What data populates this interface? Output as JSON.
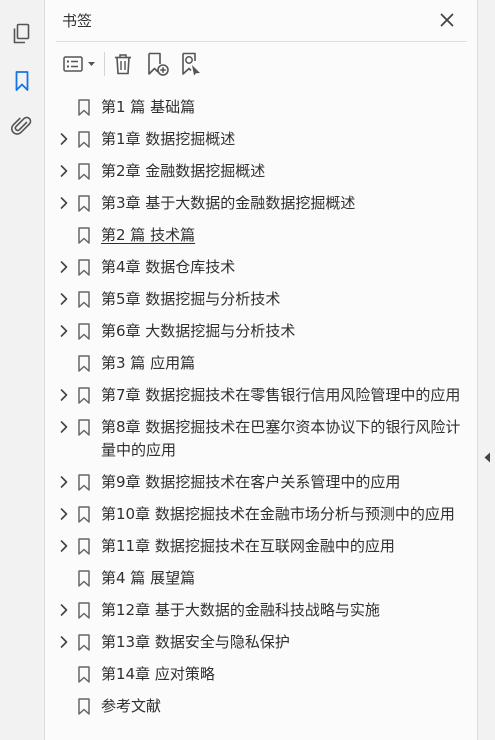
{
  "panel": {
    "title": "书签"
  },
  "left_rail": {
    "active_color": "#1473e6",
    "items": [
      {
        "name": "pages-thumbnail",
        "icon": "pages-icon"
      },
      {
        "name": "bookmarks",
        "icon": "bookmark-icon",
        "active": true
      },
      {
        "name": "attachments",
        "icon": "paperclip-icon"
      }
    ]
  },
  "toolbar": {
    "items": [
      {
        "name": "options-menu",
        "icon": "list-options-icon"
      },
      {
        "name": "delete-bookmark",
        "icon": "trash-icon"
      },
      {
        "name": "add-bookmark",
        "icon": "add-bookmark-icon"
      },
      {
        "name": "find-bookmark",
        "icon": "bookmark-search-icon"
      }
    ]
  },
  "bookmarks": [
    {
      "label": "第1 篇 基础篇",
      "expandable": false
    },
    {
      "label": "第1章 数据挖掘概述",
      "expandable": true
    },
    {
      "label": "第2章 金融数据挖掘概述",
      "expandable": true
    },
    {
      "label": "第3章 基于大数据的金融数据挖掘概述",
      "expandable": true
    },
    {
      "label": "第2 篇 技术篇",
      "expandable": false,
      "hovered": true
    },
    {
      "label": "第4章 数据仓库技术",
      "expandable": true
    },
    {
      "label": "第5章 数据挖掘与分析技术",
      "expandable": true
    },
    {
      "label": "第6章 大数据挖掘与分析技术",
      "expandable": true
    },
    {
      "label": "第3 篇 应用篇",
      "expandable": false
    },
    {
      "label": "第7章 数据挖掘技术在零售银行信用风险管理中的应用",
      "expandable": true
    },
    {
      "label": "第8章 数据挖掘技术在巴塞尔资本协议下的银行风险计量中的应用",
      "expandable": true
    },
    {
      "label": "第9章 数据挖掘技术在客户关系管理中的应用",
      "expandable": true
    },
    {
      "label": "第10章 数据挖掘技术在金融市场分析与预测中的应用",
      "expandable": true
    },
    {
      "label": "第11章 数据挖掘技术在互联网金融中的应用",
      "expandable": true
    },
    {
      "label": "第4 篇 展望篇",
      "expandable": false
    },
    {
      "label": "第12章 基于大数据的金融科技战略与实施",
      "expandable": true
    },
    {
      "label": "第13章 数据安全与隐私保护",
      "expandable": true
    },
    {
      "label": "第14章 应对策略",
      "expandable": false
    },
    {
      "label": "参考文献",
      "expandable": false
    }
  ]
}
